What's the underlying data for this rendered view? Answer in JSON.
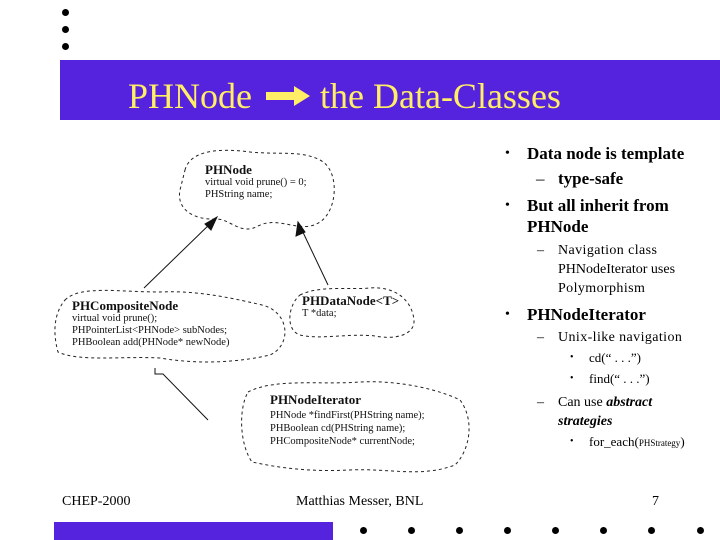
{
  "slide": {
    "title_left": "PHNode",
    "title_right": "the Data-Classes",
    "title_arrow_icon": "right-arrow-icon",
    "colors": {
      "banner": "#5522dd",
      "title_text": "#ffee66"
    }
  },
  "diagram": {
    "classes": [
      {
        "name": "PHNode",
        "members": [
          "virtual void prune() = 0;",
          "PHString name;"
        ]
      },
      {
        "name": "PHCompositeNode",
        "members": [
          "virtual void prune();",
          "PHPointerList<PHNode> subNodes;",
          "PHBoolean add(PHNode* newNode)"
        ]
      },
      {
        "name": "PHDataNode<T>",
        "members": [
          "T *data;"
        ]
      },
      {
        "name": "PHNodeIterator",
        "members": [
          "PHNode *findFirst(PHString name);",
          "PHBoolean cd(PHString name);",
          "PHCompositeNode* currentNode;"
        ]
      }
    ]
  },
  "bullets": {
    "b1": "Data node is template",
    "b1_sub": "type-safe",
    "b2_line1": "But all inherit from",
    "b2_line2": "PHNode",
    "b2_sub_line1": "Navigation class",
    "b2_sub_line2": "PHNodeIterator uses",
    "b2_sub_line3": "Polymorphism",
    "b3": "PHNodeIterator",
    "b3_sub1": "Unix-like navigation",
    "b3_sub1_item1": "cd(“ . . .”)",
    "b3_sub1_item2": "find(“ . . .”)",
    "b3_sub2_prefix": "Can use ",
    "b3_sub2_emph1": "abstract",
    "b3_sub2_emph2": "strategies",
    "b3_sub2_item1_prefix": "for_each(",
    "b3_sub2_item1_small": "PHStrategy",
    "b3_sub2_item1_suffix": ")",
    "bullet_char": "•",
    "dash_char": "–"
  },
  "footer": {
    "left": "CHEP-2000",
    "center": "Matthias Messer, BNL",
    "page_number": "7"
  }
}
